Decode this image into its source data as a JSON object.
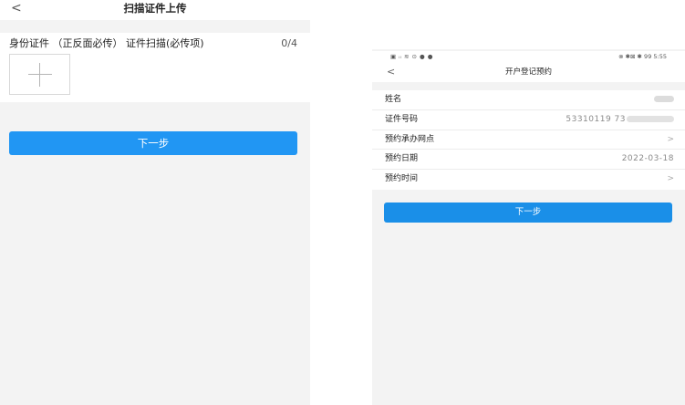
{
  "left_screen": {
    "back_icon": "chevron-left-icon",
    "back_glyph": "<",
    "title": "扫描证件上传",
    "upload": {
      "label": "身份证件 （正反面必传） 证件扫描(必传项)",
      "count": "0/4",
      "add_icon": "plus-icon"
    },
    "next_button": "下一步",
    "accent_color": "#2196f3"
  },
  "right_screen": {
    "status_bar": {
      "left": "▣ ᵢₗ ≋ ⊙ ● ●",
      "right": "⊗ ✱⊠ ✱ 99 5:55"
    },
    "back_icon": "chevron-left-icon",
    "back_glyph": "<",
    "title": "开户登记预约",
    "form": {
      "name_label": "姓名",
      "id_label": "证件号码",
      "id_value_visible": "53310119 73",
      "branch_label": "预约承办网点",
      "date_label": "预约日期",
      "date_value": "2022-03-18",
      "time_label": "预约时间",
      "arrow_glyph": ">"
    },
    "next_button": "下一步",
    "accent_color": "#1a8fe8"
  }
}
